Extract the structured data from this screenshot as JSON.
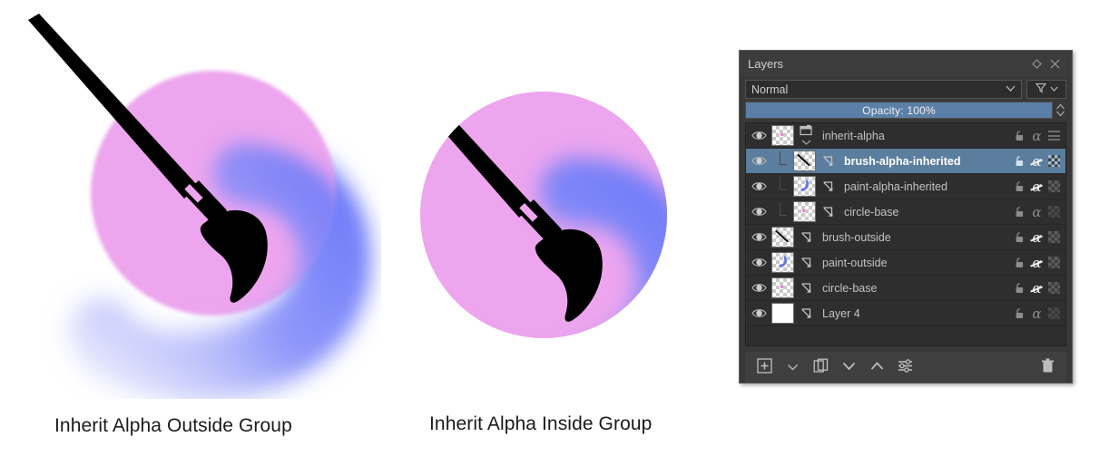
{
  "captions": {
    "left": "Inherit Alpha Outside Group",
    "right": "Inherit Alpha Inside Group"
  },
  "colors": {
    "circle_pink": "#eda5ee",
    "stroke_blue": "#7b86fa",
    "brush_black": "#000000",
    "panel_bg": "#383838",
    "list_bg": "#2e2e2e",
    "selection": "#5b7d9e",
    "slider_fill": "#5b7fa6",
    "canvas_bg": "#ffffff"
  },
  "docker": {
    "title": "Layers",
    "float_icon": "float-icon",
    "close_icon": "close-icon",
    "blend_mode": {
      "label": "Normal",
      "chevron_icon": "chevron-down-icon"
    },
    "filter": {
      "icon": "filter-funnel-icon",
      "chevron_icon": "chevron-down-icon"
    },
    "opacity": {
      "label": "Opacity:  100%",
      "value": 100,
      "spinner_icon": "spinner-updown-icon"
    },
    "layers": [
      {
        "name": "inherit-alpha",
        "visible_icon": "eye-icon",
        "type": "group",
        "type_icon": "folder-icon",
        "expand_icon": "chevron-down-icon",
        "indent": 0,
        "selected": false,
        "inherit_alpha": false,
        "inherit_alpha_icon": "",
        "lock_icon": "unlocked-icon",
        "alpha_icon": "alpha-icon",
        "alpha_lock_icon": "alpha-inherit-off",
        "right_icon": "passthrough-dashes-icon",
        "thumb": "checker-dot"
      },
      {
        "name": "brush-alpha-inherited",
        "visible_icon": "eye-icon",
        "type": "paint",
        "indent": 1,
        "selected": true,
        "inherit_alpha": true,
        "inherit_alpha_icon": "inherit-alpha-arrow-icon",
        "lock_icon": "unlocked-icon",
        "alpha_icon": "alpha-icon",
        "alpha_lock_icon": "alpha-inherit-on",
        "right_icon": "checker-icon",
        "thumb": "checker-brushstroke"
      },
      {
        "name": "paint-alpha-inherited",
        "visible_icon": "eye-icon",
        "type": "paint",
        "indent": 1,
        "selected": false,
        "inherit_alpha": true,
        "inherit_alpha_icon": "inherit-alpha-arrow-icon",
        "lock_icon": "unlocked-icon",
        "alpha_icon": "alpha-icon",
        "alpha_lock_icon": "alpha-inherit-on",
        "right_icon": "checker-icon",
        "thumb": "checker-bluecurve"
      },
      {
        "name": "circle-base",
        "visible_icon": "eye-icon",
        "type": "paint",
        "indent": 1,
        "selected": false,
        "inherit_alpha": false,
        "inherit_alpha_icon": "inherit-alpha-arrow-icon",
        "lock_icon": "unlocked-icon",
        "alpha_icon": "alpha-icon",
        "alpha_lock_icon": "alpha-inherit-off",
        "right_icon": "checker-icon",
        "thumb": "checker-dot"
      },
      {
        "name": "brush-outside",
        "visible_icon": "eye-icon",
        "type": "paint",
        "indent": 0,
        "selected": false,
        "inherit_alpha": true,
        "inherit_alpha_icon": "inherit-alpha-arrow-icon",
        "lock_icon": "unlocked-icon",
        "alpha_icon": "alpha-icon",
        "alpha_lock_icon": "alpha-inherit-on",
        "right_icon": "checker-icon",
        "thumb": "checker-brushstroke"
      },
      {
        "name": "paint-outside",
        "visible_icon": "eye-icon",
        "type": "paint",
        "indent": 0,
        "selected": false,
        "inherit_alpha": true,
        "inherit_alpha_icon": "inherit-alpha-arrow-icon",
        "lock_icon": "unlocked-icon",
        "alpha_icon": "alpha-icon",
        "alpha_lock_icon": "alpha-inherit-on",
        "right_icon": "checker-icon",
        "thumb": "checker-bluecurve"
      },
      {
        "name": "circle-base",
        "visible_icon": "eye-icon",
        "type": "paint",
        "indent": 0,
        "selected": false,
        "inherit_alpha": true,
        "inherit_alpha_icon": "inherit-alpha-arrow-icon",
        "lock_icon": "unlocked-icon",
        "alpha_icon": "alpha-icon",
        "alpha_lock_icon": "alpha-inherit-on",
        "right_icon": "checker-icon",
        "thumb": "checker-dot"
      },
      {
        "name": "Layer 4",
        "visible_icon": "eye-icon",
        "type": "paint",
        "indent": 0,
        "selected": false,
        "inherit_alpha": false,
        "inherit_alpha_icon": "inherit-alpha-arrow-icon",
        "lock_icon": "unlocked-icon",
        "alpha_icon": "alpha-icon",
        "alpha_lock_icon": "alpha-inherit-off",
        "right_icon": "checker-icon",
        "thumb": "white"
      }
    ],
    "toolbar": [
      {
        "icon": "add-layer-icon",
        "name": "add-layer-button"
      },
      {
        "icon": "chevron-down-icon",
        "name": "add-layer-menu-button"
      },
      {
        "icon": "duplicate-layer-icon",
        "name": "duplicate-layer-button"
      },
      {
        "icon": "move-down-icon",
        "name": "move-layer-down-button"
      },
      {
        "icon": "move-up-icon",
        "name": "move-layer-up-button"
      },
      {
        "icon": "layer-properties-icon",
        "name": "layer-properties-button"
      },
      {
        "icon": "trash-icon",
        "name": "delete-layer-button"
      }
    ]
  }
}
